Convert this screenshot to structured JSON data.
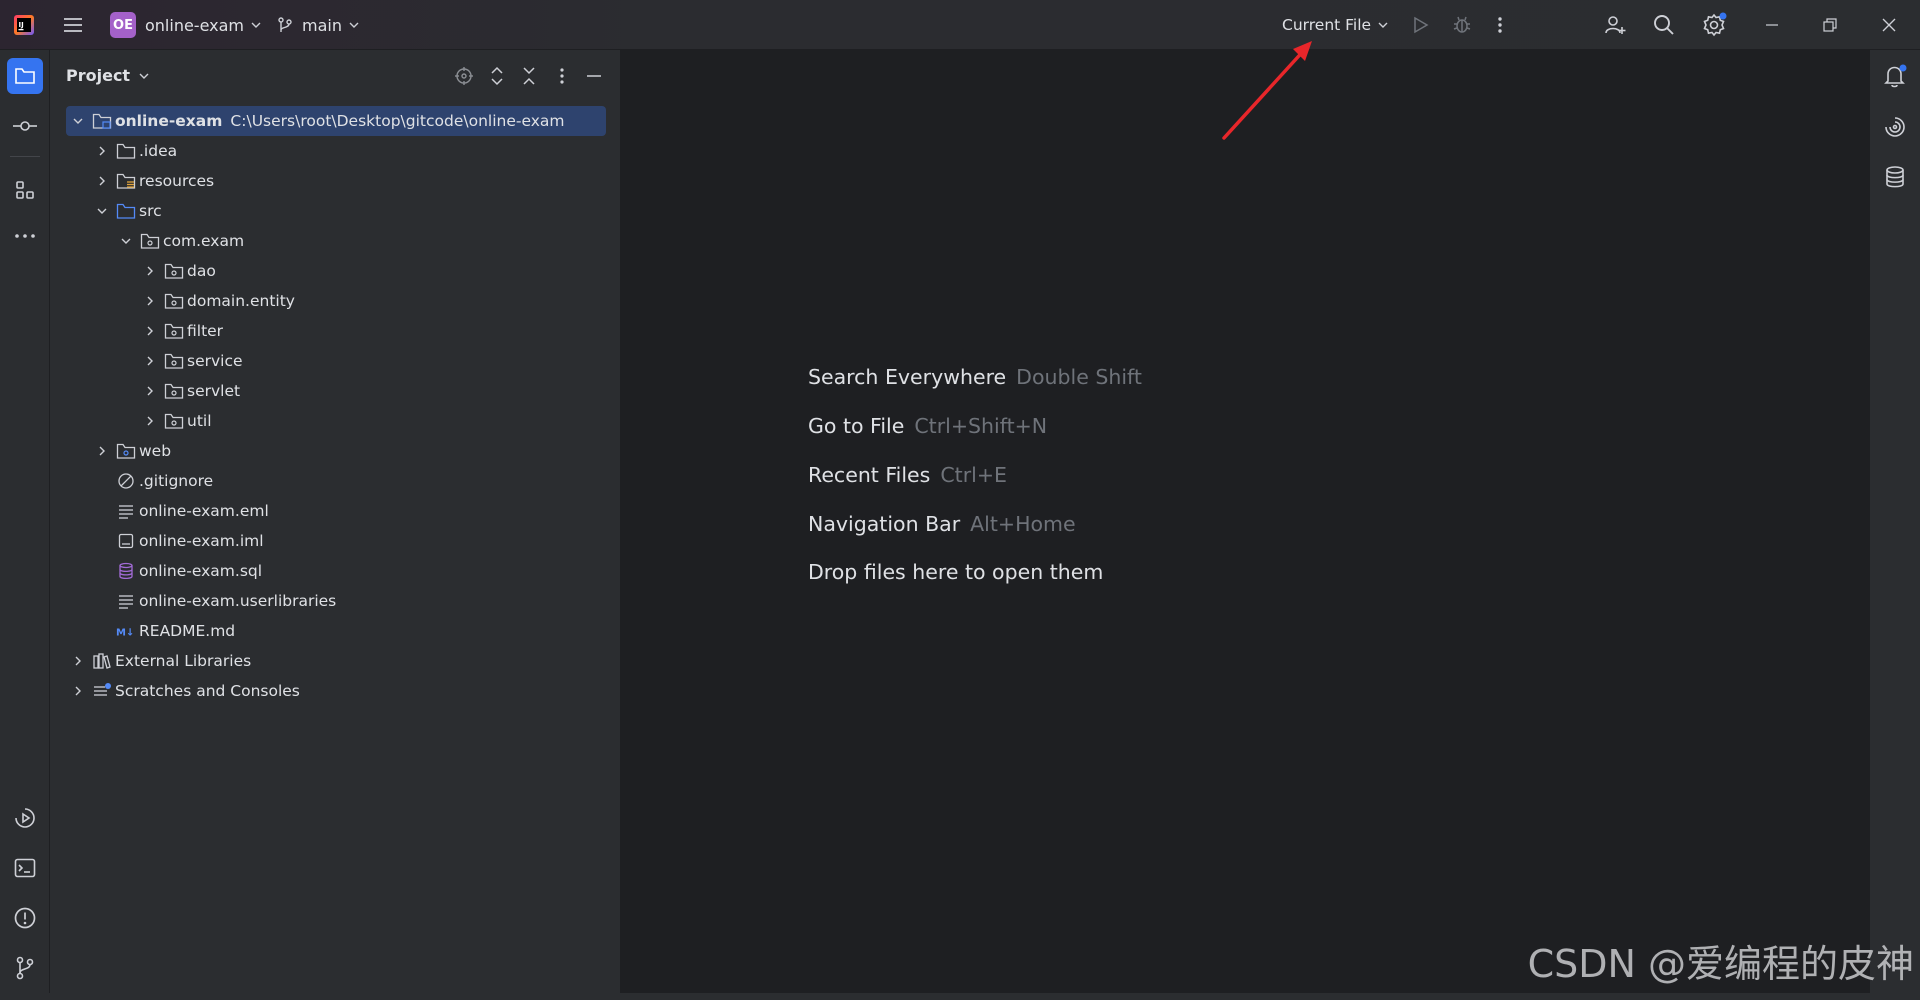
{
  "titlebar": {
    "project_badge": "OE",
    "project_name": "online-exam",
    "branch": "main",
    "run_config": "Current File"
  },
  "project_panel": {
    "title": "Project",
    "tree": [
      {
        "label": "online-exam",
        "path": "C:\\Users\\root\\Desktop\\gitcode\\online-exam",
        "icon": "module-folder-icon",
        "expanded": true
      },
      {
        "label": ".idea",
        "icon": "folder-icon",
        "expanded": false
      },
      {
        "label": "resources",
        "icon": "resources-folder-icon",
        "expanded": false
      },
      {
        "label": "src",
        "icon": "source-folder-icon",
        "expanded": true
      },
      {
        "label": "com.exam",
        "icon": "package-icon",
        "expanded": true
      },
      {
        "label": "dao",
        "icon": "package-icon",
        "expanded": false
      },
      {
        "label": "domain.entity",
        "icon": "package-icon",
        "expanded": false
      },
      {
        "label": "filter",
        "icon": "package-icon",
        "expanded": false
      },
      {
        "label": "service",
        "icon": "package-icon",
        "expanded": false
      },
      {
        "label": "servlet",
        "icon": "package-icon",
        "expanded": false
      },
      {
        "label": "util",
        "icon": "package-icon",
        "expanded": false
      },
      {
        "label": "web",
        "icon": "web-folder-icon",
        "expanded": false
      },
      {
        "label": ".gitignore",
        "icon": "ignore-file-icon"
      },
      {
        "label": "online-exam.eml",
        "icon": "text-file-icon"
      },
      {
        "label": "online-exam.iml",
        "icon": "module-file-icon"
      },
      {
        "label": "online-exam.sql",
        "icon": "database-file-icon"
      },
      {
        "label": "online-exam.userlibraries",
        "icon": "text-file-icon"
      },
      {
        "label": "README.md",
        "icon": "markdown-icon"
      },
      {
        "label": "External Libraries",
        "icon": "library-icon",
        "expanded": false
      },
      {
        "label": "Scratches and Consoles",
        "icon": "scratches-icon",
        "expanded": false
      }
    ]
  },
  "editor": {
    "hints": [
      {
        "action": "Search Everywhere",
        "shortcut": "Double Shift"
      },
      {
        "action": "Go to File",
        "shortcut": "Ctrl+Shift+N"
      },
      {
        "action": "Recent Files",
        "shortcut": "Ctrl+E"
      },
      {
        "action": "Navigation Bar",
        "shortcut": "Alt+Home"
      },
      {
        "action": "Drop files here to open them",
        "shortcut": ""
      }
    ]
  },
  "watermark": "CSDN @爱编程的皮神",
  "colors": {
    "accent": "#3574f0",
    "selection": "#2e436e",
    "annotation": "#e8262a",
    "badge": "#a461c9"
  }
}
